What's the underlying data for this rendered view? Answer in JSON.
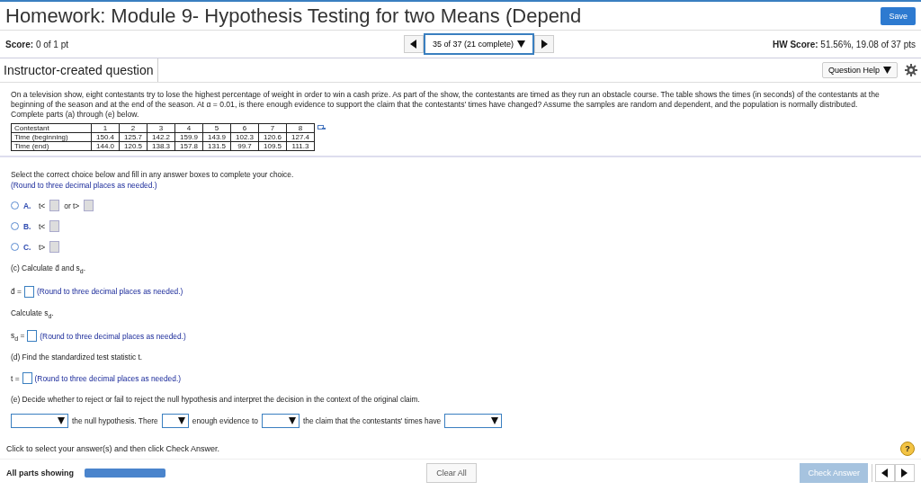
{
  "header": {
    "title": "Homework: Module 9- Hypothesis Testing for two Means (Depend",
    "save": "Save"
  },
  "score_bar": {
    "score": "**Score:** 0 of 1 pt",
    "navigator": "35 of 37 (21 complete)",
    "hw_score": "**HW Score:** 51.56%, 19.08 of 37 pts"
  },
  "question_bar": {
    "title": "Instructor-created question",
    "help": "Question Help"
  },
  "question": {
    "text": "On a television show, eight contestants try to lose the highest percentage of weight in order to win a cash prize. As part of the show, the contestants are timed as they run an obstacle course. The table shows the times (in seconds) of the contestants at the beginning of the season and at the end of the season. At α = 0.01, is there enough evidence to support the claim that the contestants' times have changed? Assume the samples are random and dependent, and the population is normally distributed. Complete parts (a) through (e) below.",
    "table": [
      [
        "Contestant",
        "1",
        "2",
        "3",
        "4",
        "5",
        "6",
        "7",
        "8"
      ],
      [
        "Time (beginning)",
        "150.4",
        "125.7",
        "142.2",
        "159.9",
        "143.9",
        "102.3",
        "120.6",
        "127.4"
      ],
      [
        "Time (end)",
        "144.0",
        "120.5",
        "138.3",
        "157.8",
        "131.5",
        "99.7",
        "109.5",
        "111.3"
      ]
    ]
  },
  "part_b": {
    "instruction": "Select the correct choice below and fill in any answer boxes to complete your choice.",
    "hint": "(Round to three decimal places as needed.)",
    "choices": [
      {
        "letter": "A.",
        "selected": false,
        "parts": [
          {
            "kind": "text",
            "text": "t<"
          },
          {
            "kind": "box"
          },
          {
            "kind": "text",
            "text": "or t>"
          },
          {
            "kind": "box"
          }
        ]
      },
      {
        "letter": "B.",
        "selected": false,
        "parts": [
          {
            "kind": "text",
            "text": "t<"
          },
          {
            "kind": "box"
          }
        ]
      },
      {
        "letter": "C.",
        "selected": false,
        "parts": [
          {
            "kind": "text",
            "text": "t>"
          },
          {
            "kind": "box"
          }
        ]
      }
    ]
  },
  "part_c": {
    "heading": "(c) Calculate d̄ and s$_{d}$.",
    "dbar_label": "d̄ =",
    "dbar_hint": "(Round to three decimal places as needed.)",
    "sd_heading": "Calculate s$_{d}$.",
    "sd_label": "s$_{d}$ =",
    "sd_hint": "(Round to three decimal places as needed.)"
  },
  "part_d": {
    "heading": "(d) Find the standardized test statistic t.",
    "label": "t =",
    "hint": "(Round to three decimal places as needed.)"
  },
  "part_e": {
    "heading": "(e) Decide whether to reject or fail to reject the null hypothesis and interpret the decision in the context of the original claim.",
    "sentence": [
      {
        "kind": "dropdown"
      },
      {
        "kind": "text",
        "text": "the null hypothesis. There"
      },
      {
        "kind": "dropdown"
      },
      {
        "kind": "text",
        "text": "enough evidence to"
      },
      {
        "kind": "dropdown"
      },
      {
        "kind": "text",
        "text": "the claim that the contestants' times have"
      },
      {
        "kind": "dropdown"
      }
    ]
  },
  "footer": {
    "instruction": "Click to select your answer(s) and then click Check Answer.",
    "help": "?",
    "parts_label": "All parts showing",
    "clear": "Clear All",
    "check": "Check Answer",
    "check_disabled": true
  }
}
